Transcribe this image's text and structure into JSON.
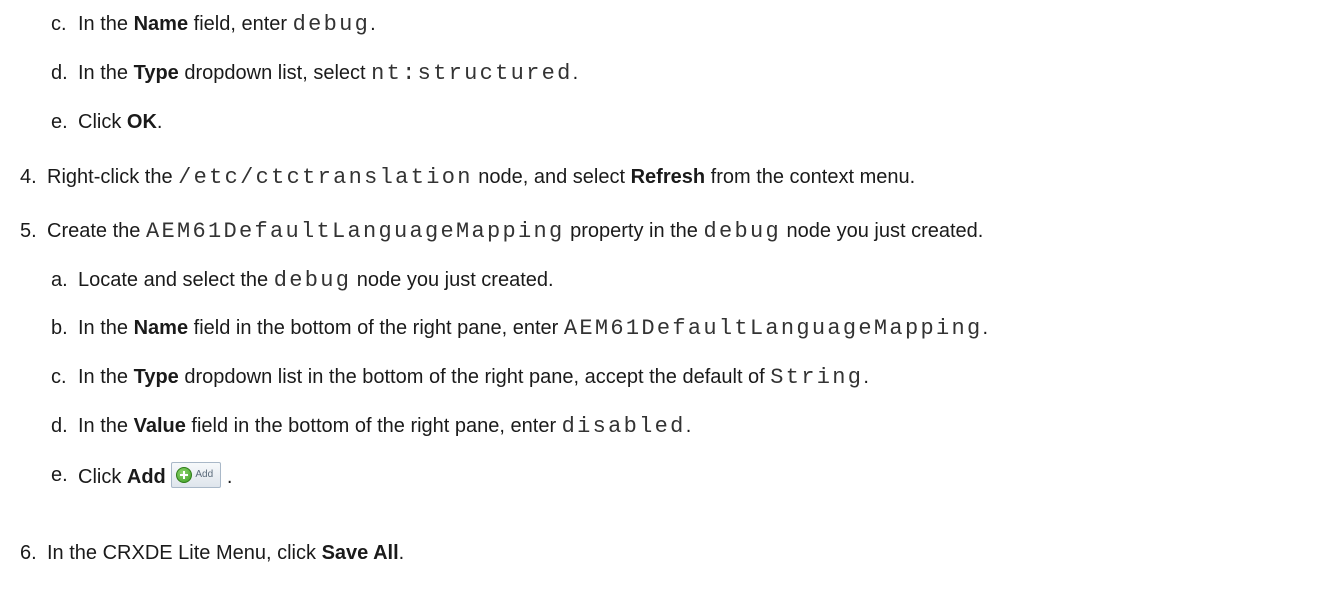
{
  "steps": {
    "c1": {
      "num": "c.",
      "pre": "In the ",
      "bold": "Name",
      "mid": " field, enter ",
      "code": "debug",
      "end": "."
    },
    "d1": {
      "num": "d.",
      "pre": "In the ",
      "bold": "Type",
      "mid": " dropdown list, select ",
      "code": "nt:structured",
      "end": "."
    },
    "e1": {
      "num": "e.",
      "pre": "Click ",
      "bold": "OK",
      "end": "."
    },
    "s4": {
      "num": "4.",
      "pre": "Right-click the ",
      "code": "/etc/ctctranslation",
      "mid": " node, and select ",
      "bold": "Refresh",
      "end": " from the context menu."
    },
    "s5": {
      "num": "5.",
      "pre": "Create the ",
      "code": "AEM61DefaultLanguageMapping",
      "mid": " property in the ",
      "code2": "debug",
      "end": " node you just created."
    },
    "a5": {
      "num": "a.",
      "pre": "Locate and select the ",
      "code": "debug",
      "end": " node you just created."
    },
    "b5": {
      "num": "b.",
      "pre": "In the ",
      "bold": "Name",
      "mid": " field in the bottom of the right pane, enter ",
      "code": "AEM61DefaultLanguageMapping",
      "end": "."
    },
    "c5": {
      "num": "c.",
      "pre": "In the ",
      "bold": "Type",
      "mid": " dropdown list in the bottom of the right pane, accept the default of ",
      "code": "String",
      "end": "."
    },
    "d5": {
      "num": "d.",
      "pre": "In the ",
      "bold": "Value",
      "mid": " field in the bottom of the right pane, enter ",
      "code": "disabled",
      "end": "."
    },
    "e5": {
      "num": "e.",
      "pre": "Click ",
      "bold": "Add",
      "button_label": "Add",
      "end": "."
    },
    "s6": {
      "num": "6.",
      "pre": "In the CRXDE Lite Menu, click ",
      "bold": "Save All",
      "end": "."
    }
  },
  "icons": {
    "add_button_icon": "green-plus-circle-icon"
  },
  "colors": {
    "text": "#1a1a1a",
    "code": "#333333",
    "button_border": "#a9b8c8"
  }
}
